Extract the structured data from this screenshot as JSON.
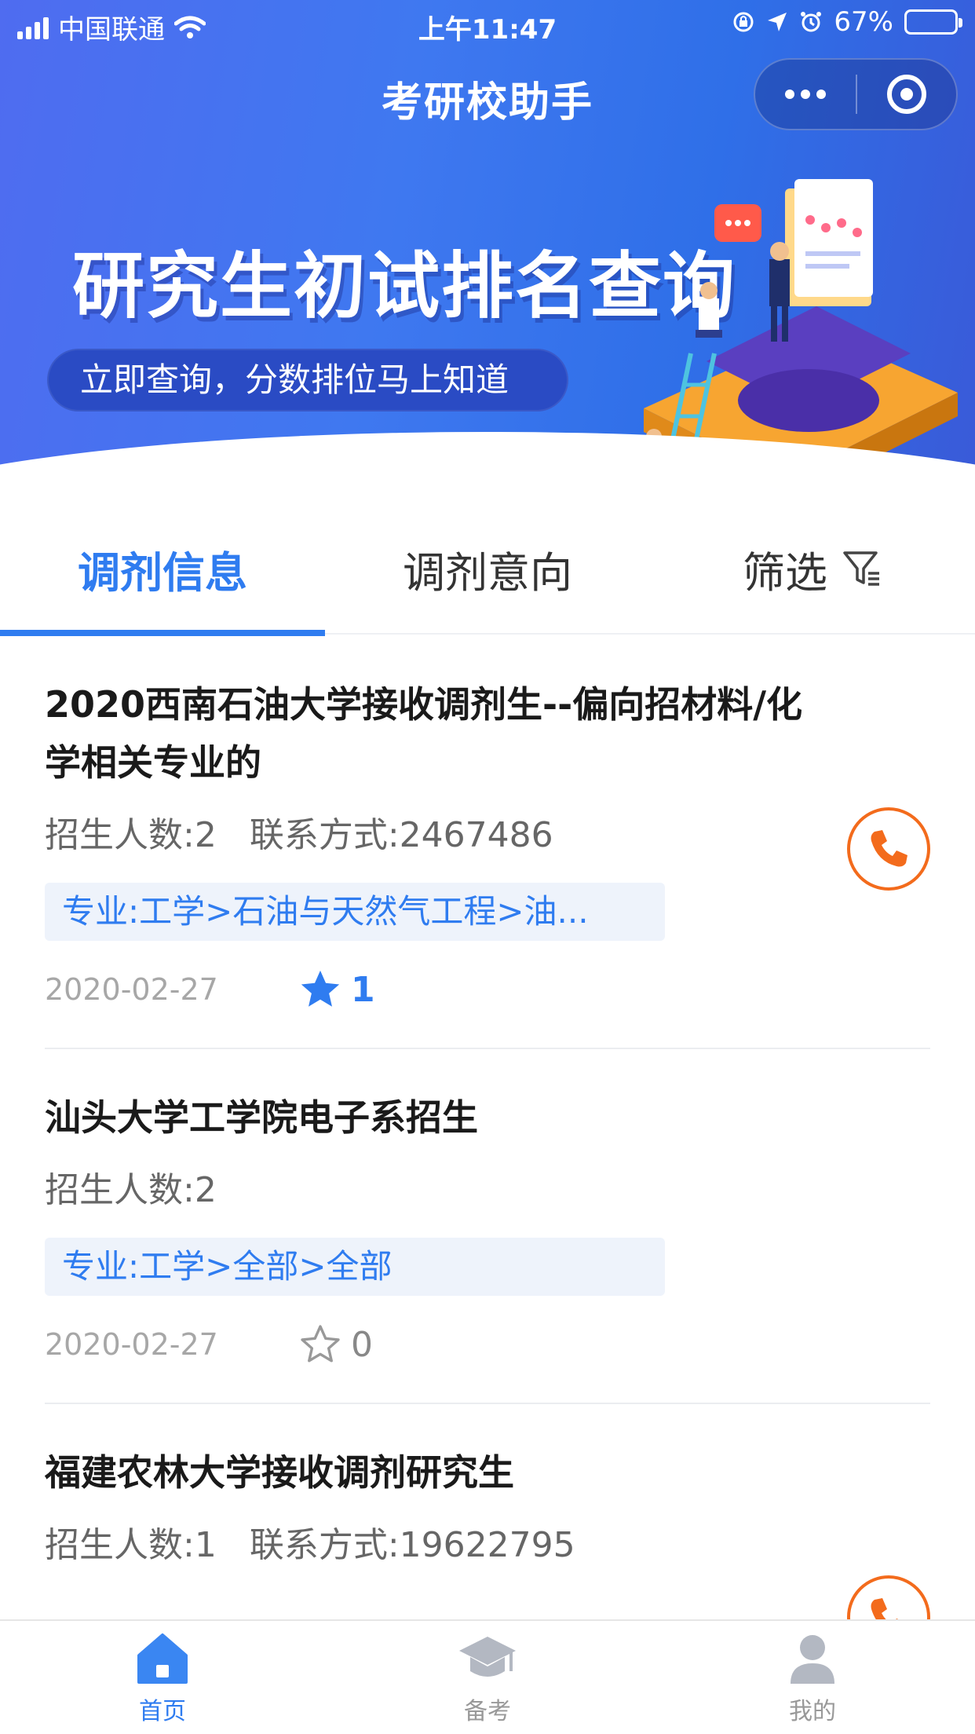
{
  "status_bar": {
    "carrier": "中国联通",
    "time": "上午11:47",
    "battery": "67%",
    "battery_level": 0.67
  },
  "nav": {
    "title": "考研校助手"
  },
  "banner": {
    "title": "研究生初试排名查询",
    "subtitle": "立即查询，分数排位马上知道"
  },
  "tabs": [
    {
      "label": "调剂信息",
      "active": true
    },
    {
      "label": "调剂意向",
      "active": false
    },
    {
      "label": "筛选",
      "icon": "filter-icon",
      "active": false
    }
  ],
  "listings": [
    {
      "title": "2020西南石油大学接收调剂生--偏向招材料/化学相关专业的",
      "enrollment": "招生人数:2",
      "contact": "联系方式:2467486",
      "major": "专业:工学>石油与天然气工程>油...",
      "date": "2020-02-27",
      "favorites": "1",
      "favorited": true,
      "has_phone": true
    },
    {
      "title": "汕头大学工学院电子系招生",
      "enrollment": "招生人数:2",
      "contact": "",
      "major": "专业:工学>全部>全部",
      "date": "2020-02-27",
      "favorites": "0",
      "favorited": false,
      "has_phone": false
    },
    {
      "title": "福建农林大学接收调剂研究生",
      "enrollment": "招生人数:1",
      "contact": "联系方式:19622795",
      "major": "",
      "date": "",
      "favorites": "",
      "favorited": false,
      "has_phone": true
    }
  ],
  "tabbar": [
    {
      "label": "首页",
      "icon": "home-icon",
      "active": true
    },
    {
      "label": "备考",
      "icon": "graduation-cap-icon",
      "active": false
    },
    {
      "label": "我的",
      "icon": "user-icon",
      "active": false
    }
  ],
  "colors": {
    "accent": "#2f7cf0",
    "phone": "#f36b1c",
    "header_gradient_start": "#4f6cf0",
    "header_gradient_end": "#3a5ad8"
  }
}
